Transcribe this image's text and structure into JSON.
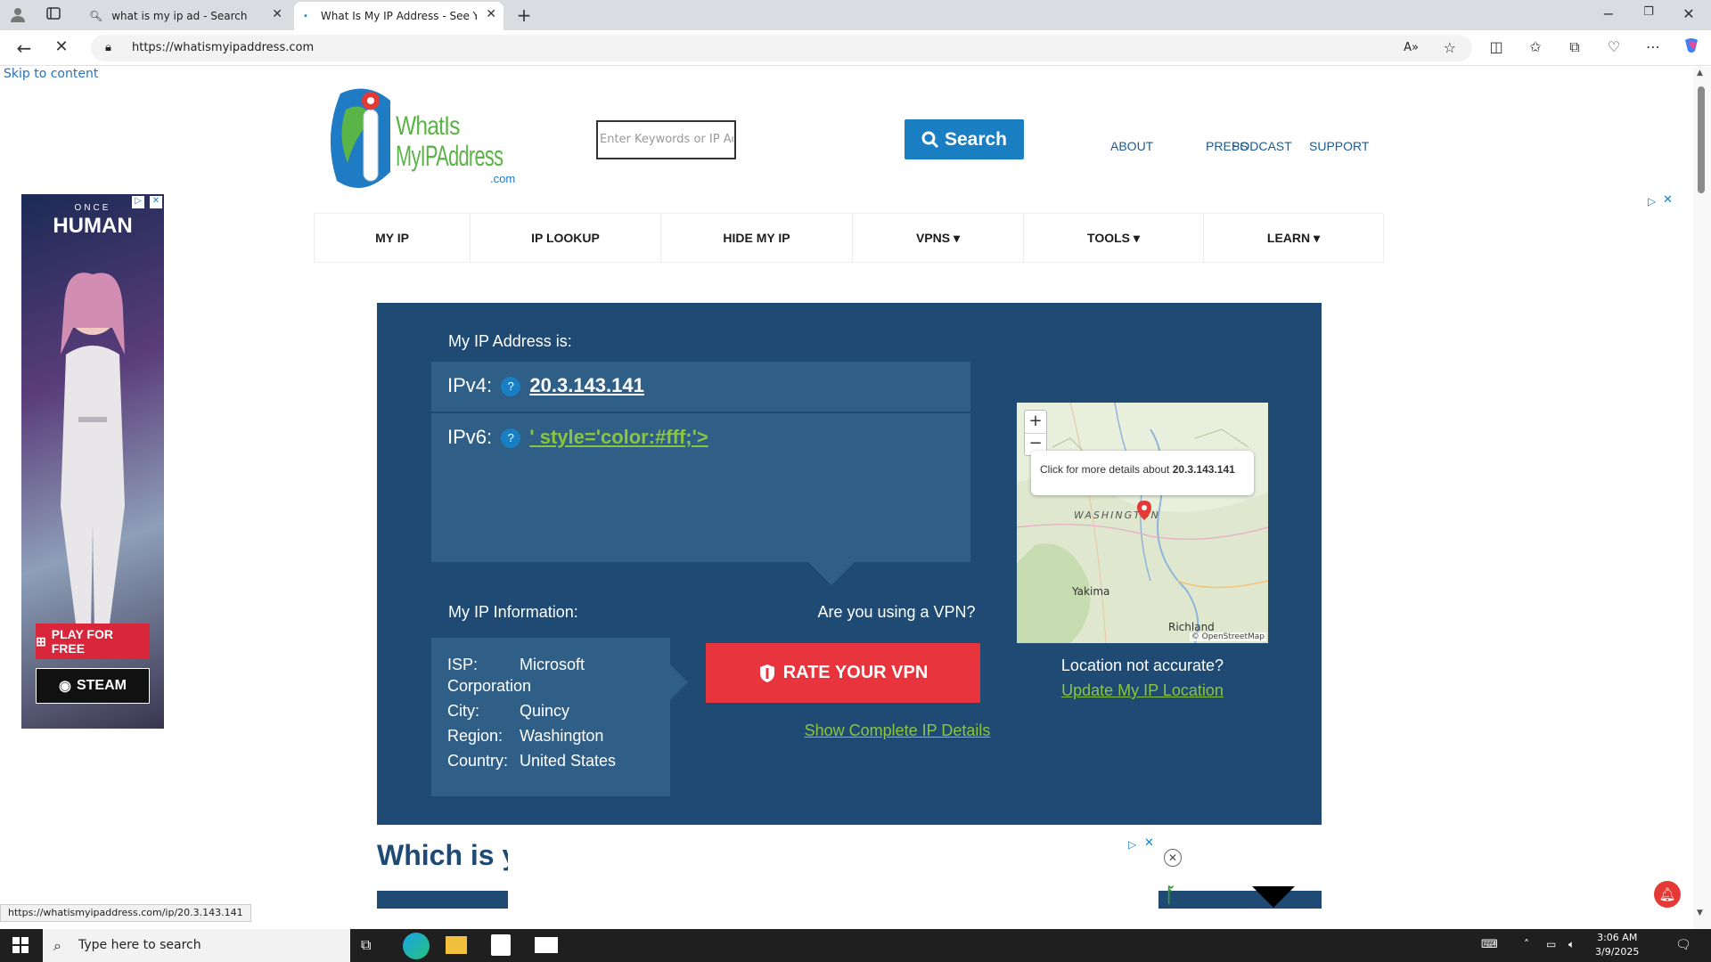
{
  "browser": {
    "tabs": [
      {
        "title": "what is my ip ad - Search"
      },
      {
        "title": "What Is My IP Address - See Your"
      }
    ],
    "url": "https://whatismyipaddress.com"
  },
  "page": {
    "skip_link": "Skip to content",
    "logo": {
      "line1": "WhatIs",
      "line2": "MyIPAddress",
      "line3": ".com"
    },
    "search": {
      "placeholder": "Enter Keywords or IP Ac",
      "button": "Search"
    },
    "top_links": [
      "ABOUT",
      "PRESS",
      "PODCAST",
      "SUPPORT"
    ],
    "nav": [
      "MY IP",
      "IP LOOKUP",
      "HIDE MY IP",
      "VPNS ▾",
      "TOOLS ▾",
      "LEARN ▾"
    ],
    "hero": {
      "my_ip_label": "My IP Address is:",
      "ipv4_label": "IPv4:",
      "ipv4_value": "20.3.143.141",
      "ipv6_label": "IPv6:",
      "ipv6_value": "' style='color:#fff;'>",
      "info_title": "My IP Information:",
      "info": [
        {
          "key": "ISP:",
          "value": "Microsoft"
        },
        {
          "key": "",
          "value": "Corporation"
        },
        {
          "key": "City:",
          "value": "Quincy"
        },
        {
          "key": "Region:",
          "value": "Washington"
        },
        {
          "key": "Country:",
          "value": "United States"
        }
      ],
      "vpn_question": "Are you using a VPN?",
      "rate_vpn": "RATE YOUR VPN",
      "show_details": "Show Complete IP Details",
      "location_not_accurate": "Location not accurate?",
      "update_location": "Update My IP Location"
    },
    "map": {
      "tooltip_prefix": "Click for more details about",
      "tooltip_ip": "20.3.143.141",
      "place_washington": "WASHINGTON",
      "place_yakima": "Yakima",
      "place_richland": "Richland",
      "attribution": "© OpenStreetMap",
      "zoom_in": "+",
      "zoom_out": "−"
    },
    "section_heading": "Which is y",
    "left_ad": {
      "top_small": "ONCE",
      "brand": "HUMAN",
      "play": "PLAY FOR FREE",
      "steam": "STEAM"
    }
  },
  "status_bar": "https://whatismyipaddress.com/ip/20.3.143.141",
  "taskbar": {
    "search_placeholder": "Type here to search",
    "time": "3:06 AM",
    "date": "3/9/2025"
  }
}
